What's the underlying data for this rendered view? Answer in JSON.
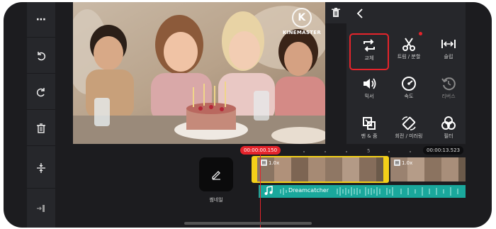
{
  "watermark": {
    "logo_letter": "K",
    "text": "KINEMASTER"
  },
  "rail": {
    "more_label": "⋯"
  },
  "tools": {
    "replace_label": "교체",
    "trim_split_label": "트림 / 분할",
    "slip_label": "슬립",
    "mixer_label": "믹서",
    "speed_label": "속도",
    "reverse_label": "리버스",
    "pan_zoom_label": "팬 & 줌",
    "rotate_mirror_label": "회전 / 미러링",
    "filter_label": "필터"
  },
  "timeline": {
    "current_time": "00:00:00.150",
    "end_time": "00:00:13.523",
    "ruler_mark": "5",
    "thumbnail_label": "썸네일",
    "clip1_speed": "1.0x",
    "clip2_speed": "1.0x",
    "audio_title": "Dreamcatcher"
  },
  "colors": {
    "accent_red": "#e5242b",
    "selection_yellow": "#f3d019",
    "audio_teal": "#1aa89c",
    "panel_bg": "#26272b"
  }
}
